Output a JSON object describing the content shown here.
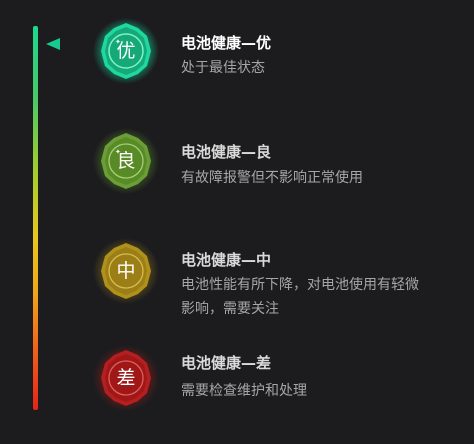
{
  "levels": [
    {
      "title": "电池健康—优",
      "description": "处于最佳状态",
      "badge_char": "优",
      "badge_icon": "excellent-badge-icon",
      "color": "#14b07f",
      "active": true
    },
    {
      "title": "电池健康—良",
      "description": "有故障报警但不影响正常使用",
      "badge_char": "良",
      "badge_icon": "good-badge-icon",
      "color": "#5f9a2a"
    },
    {
      "title": "电池健康—中",
      "description": "电池性能有所下降，对电池使用有轻微影响，需要关注",
      "badge_char": "中",
      "badge_icon": "medium-badge-icon",
      "color": "#a4881a"
    },
    {
      "title": "电池健康—差",
      "description": "需要检查维护和处理",
      "badge_char": "差",
      "badge_icon": "poor-badge-icon",
      "color": "#ac1a1a"
    }
  ],
  "scale": {
    "gradient_colors": [
      "#1bd98f",
      "#e7c81d",
      "#e2241b"
    ],
    "pointer_color": "#18c98e"
  }
}
